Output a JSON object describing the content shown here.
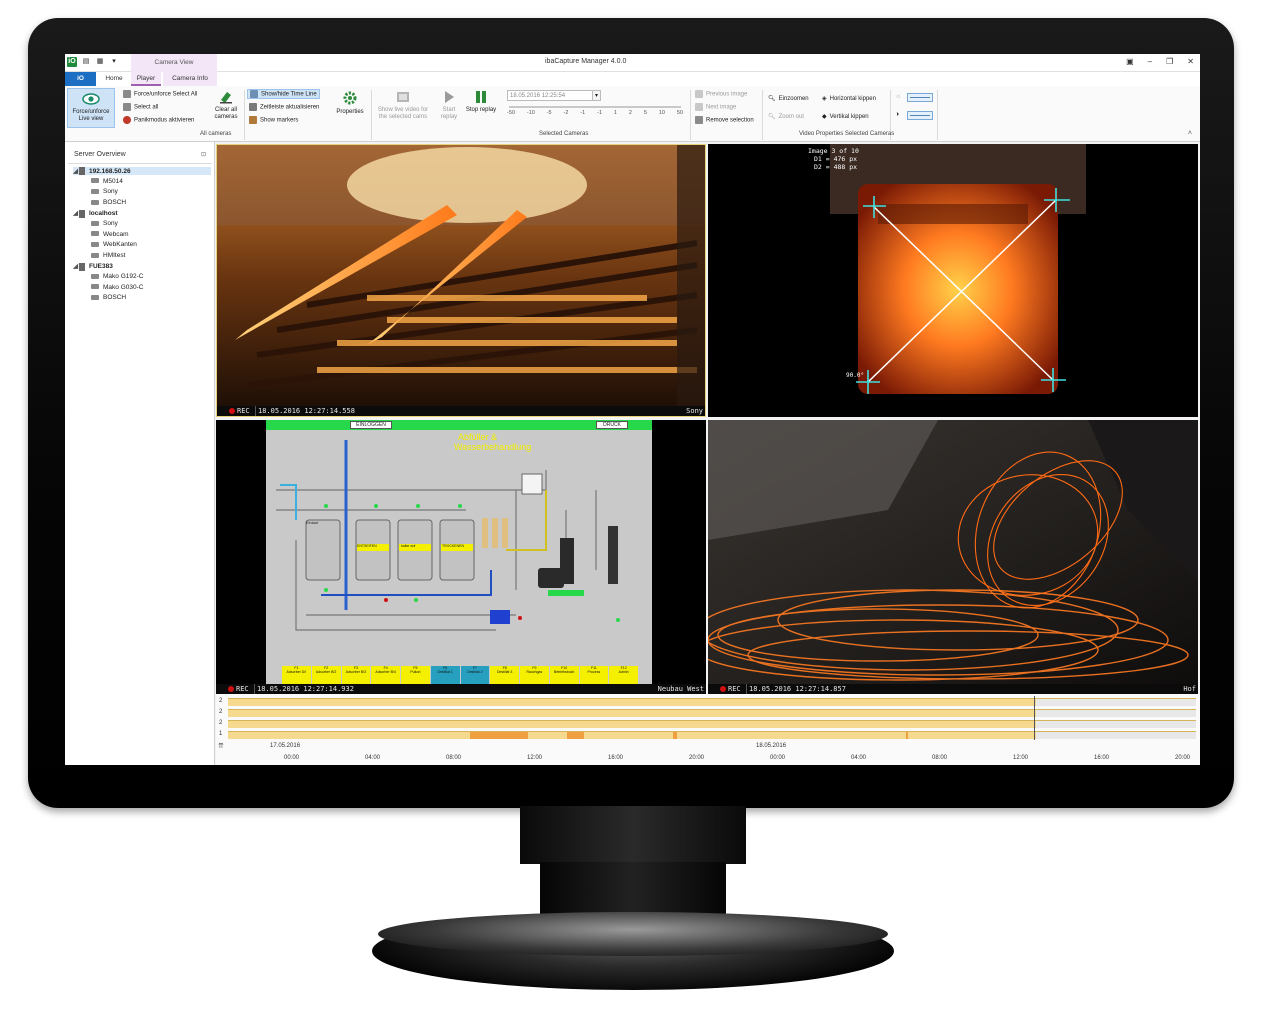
{
  "window": {
    "app_title": "ibaCapture Manager 4.0.0",
    "context_group": "Camera View"
  },
  "tabs": {
    "file": "iO",
    "home": "Home",
    "player": "Player",
    "camera_info": "Camera Info"
  },
  "ribbon": {
    "force_unforce_live_view_1": "Force/unforce",
    "force_unforce_live_view_2": "Live view",
    "force_unforce_select_all": "Force/unforce Select All",
    "select_all": "Select all",
    "panic_mode": "Panikmodus aktivieren",
    "clear_all_cameras_1": "Clear all",
    "clear_all_cameras_2": "cameras",
    "group_all_cameras": "All cameras",
    "show_hide_timeline": "Show/hide Time Line",
    "update_timeline": "Zeitleiste aktualisieren",
    "show_markers": "Show markers",
    "properties": "Properties",
    "show_live_video_1": "Show live video for",
    "show_live_video_2": "the selected cams",
    "start_replay_1": "Start",
    "start_replay_2": "replay",
    "stop_replay": "Stop replay",
    "replay_time": "18.05.2016 12:25:54",
    "speed_scale": [
      "-50",
      "-10",
      "-5",
      "-2",
      "-1",
      "-1",
      "1",
      "2",
      "5",
      "10",
      "50"
    ],
    "group_selected_cameras": "Selected Cameras",
    "previous_image": "Previous image",
    "next_image": "Next image",
    "remove_selection": "Remove selection",
    "zoom_in": "Einzoomen",
    "zoom_out": "Zoom out",
    "flip_horizontal": "Horizontal kippen",
    "flip_vertical": "Vertikal kippen",
    "group_video_properties": "Video Properties Selected Cameras"
  },
  "sidebar": {
    "title": "Server Overview",
    "servers": [
      {
        "name": "192.168.50.26",
        "devices": [
          "M5014",
          "Sony",
          "BOSCH"
        ]
      },
      {
        "name": "localhost",
        "devices": [
          "Sony",
          "Webcam",
          "WebKanten",
          "HMItest"
        ]
      },
      {
        "name": "FUE383",
        "devices": [
          "Mako G192-C",
          "Mako G030-C",
          "BOSCH"
        ]
      }
    ]
  },
  "videos": [
    {
      "rec": "REC",
      "timestamp": "18.05.2016 12:27:14.558",
      "camera": "Sony"
    },
    {
      "rec": "",
      "timestamp": "",
      "camera": "",
      "overlay": [
        "Image 3 of 10",
        "D1 = 476 px",
        "D2 = 488 px"
      ],
      "angle": "90.0°"
    },
    {
      "rec": "REC",
      "timestamp": "18.05.2016 12:27:14.932",
      "camera": "Neubau West"
    },
    {
      "rec": "REC",
      "timestamp": "18.05.2016 12:27:14.857",
      "camera": "Hof"
    }
  ],
  "timeline": {
    "tracks": [
      "2",
      "2",
      "2",
      "1"
    ],
    "dates": [
      "17.05.2016",
      "18.05.2016"
    ],
    "hours": [
      "00:00",
      "04:00",
      "08:00",
      "12:00",
      "16:00",
      "20:00",
      "00:00",
      "04:00",
      "08:00",
      "12:00",
      "16:00",
      "20:00"
    ],
    "colors": {
      "recorded": "#f4d98e",
      "event": "#f0a040",
      "future": "#e8e8e8"
    }
  },
  "scada": {
    "title_1": "Abfüller &",
    "title_2": "Wasserbehandlung",
    "buttons": [
      "EINLOGGEN",
      "DRUCK"
    ],
    "tanks": [
      "Einlauf",
      "ENTSEIFEN",
      "kalter auf",
      "TROCKENEN"
    ],
    "fkeys": [
      "F1",
      "F2",
      "F3",
      "F4",
      "F5",
      "F6",
      "F7",
      "F8",
      "F9",
      "F10",
      "F11",
      "F12"
    ],
    "fkey_labels": [
      "Adsorber D/I",
      "Adsorber B/2",
      "Adsorber B/3",
      "Adsorber B/4",
      "Pulizzi",
      "Destillat 1",
      "Destillat 2",
      "Destillat 3",
      "Rauchgas",
      "Betriebsbuch",
      "Process",
      "Admin"
    ],
    "fkey_labels_2": [
      "Übersicht",
      "",
      "",
      "",
      "Wasser",
      "Destillat",
      "Abwasser",
      "Waschgitter",
      "Heat Seal",
      "Pumps",
      "Adsorb",
      "Analyse",
      "Meldungen"
    ]
  }
}
